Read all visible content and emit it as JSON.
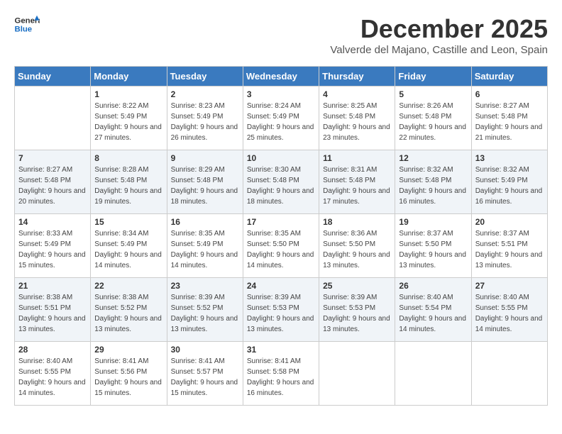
{
  "logo": {
    "general": "General",
    "blue": "Blue"
  },
  "title": "December 2025",
  "subtitle": "Valverde del Majano, Castille and Leon, Spain",
  "days_of_week": [
    "Sunday",
    "Monday",
    "Tuesday",
    "Wednesday",
    "Thursday",
    "Friday",
    "Saturday"
  ],
  "weeks": [
    [
      {
        "day": "",
        "sunrise": "",
        "sunset": "",
        "daylight": ""
      },
      {
        "day": "1",
        "sunrise": "Sunrise: 8:22 AM",
        "sunset": "Sunset: 5:49 PM",
        "daylight": "Daylight: 9 hours and 27 minutes."
      },
      {
        "day": "2",
        "sunrise": "Sunrise: 8:23 AM",
        "sunset": "Sunset: 5:49 PM",
        "daylight": "Daylight: 9 hours and 26 minutes."
      },
      {
        "day": "3",
        "sunrise": "Sunrise: 8:24 AM",
        "sunset": "Sunset: 5:49 PM",
        "daylight": "Daylight: 9 hours and 25 minutes."
      },
      {
        "day": "4",
        "sunrise": "Sunrise: 8:25 AM",
        "sunset": "Sunset: 5:48 PM",
        "daylight": "Daylight: 9 hours and 23 minutes."
      },
      {
        "day": "5",
        "sunrise": "Sunrise: 8:26 AM",
        "sunset": "Sunset: 5:48 PM",
        "daylight": "Daylight: 9 hours and 22 minutes."
      },
      {
        "day": "6",
        "sunrise": "Sunrise: 8:27 AM",
        "sunset": "Sunset: 5:48 PM",
        "daylight": "Daylight: 9 hours and 21 minutes."
      }
    ],
    [
      {
        "day": "7",
        "sunrise": "Sunrise: 8:27 AM",
        "sunset": "Sunset: 5:48 PM",
        "daylight": "Daylight: 9 hours and 20 minutes."
      },
      {
        "day": "8",
        "sunrise": "Sunrise: 8:28 AM",
        "sunset": "Sunset: 5:48 PM",
        "daylight": "Daylight: 9 hours and 19 minutes."
      },
      {
        "day": "9",
        "sunrise": "Sunrise: 8:29 AM",
        "sunset": "Sunset: 5:48 PM",
        "daylight": "Daylight: 9 hours and 18 minutes."
      },
      {
        "day": "10",
        "sunrise": "Sunrise: 8:30 AM",
        "sunset": "Sunset: 5:48 PM",
        "daylight": "Daylight: 9 hours and 18 minutes."
      },
      {
        "day": "11",
        "sunrise": "Sunrise: 8:31 AM",
        "sunset": "Sunset: 5:48 PM",
        "daylight": "Daylight: 9 hours and 17 minutes."
      },
      {
        "day": "12",
        "sunrise": "Sunrise: 8:32 AM",
        "sunset": "Sunset: 5:48 PM",
        "daylight": "Daylight: 9 hours and 16 minutes."
      },
      {
        "day": "13",
        "sunrise": "Sunrise: 8:32 AM",
        "sunset": "Sunset: 5:49 PM",
        "daylight": "Daylight: 9 hours and 16 minutes."
      }
    ],
    [
      {
        "day": "14",
        "sunrise": "Sunrise: 8:33 AM",
        "sunset": "Sunset: 5:49 PM",
        "daylight": "Daylight: 9 hours and 15 minutes."
      },
      {
        "day": "15",
        "sunrise": "Sunrise: 8:34 AM",
        "sunset": "Sunset: 5:49 PM",
        "daylight": "Daylight: 9 hours and 14 minutes."
      },
      {
        "day": "16",
        "sunrise": "Sunrise: 8:35 AM",
        "sunset": "Sunset: 5:49 PM",
        "daylight": "Daylight: 9 hours and 14 minutes."
      },
      {
        "day": "17",
        "sunrise": "Sunrise: 8:35 AM",
        "sunset": "Sunset: 5:50 PM",
        "daylight": "Daylight: 9 hours and 14 minutes."
      },
      {
        "day": "18",
        "sunrise": "Sunrise: 8:36 AM",
        "sunset": "Sunset: 5:50 PM",
        "daylight": "Daylight: 9 hours and 13 minutes."
      },
      {
        "day": "19",
        "sunrise": "Sunrise: 8:37 AM",
        "sunset": "Sunset: 5:50 PM",
        "daylight": "Daylight: 9 hours and 13 minutes."
      },
      {
        "day": "20",
        "sunrise": "Sunrise: 8:37 AM",
        "sunset": "Sunset: 5:51 PM",
        "daylight": "Daylight: 9 hours and 13 minutes."
      }
    ],
    [
      {
        "day": "21",
        "sunrise": "Sunrise: 8:38 AM",
        "sunset": "Sunset: 5:51 PM",
        "daylight": "Daylight: 9 hours and 13 minutes."
      },
      {
        "day": "22",
        "sunrise": "Sunrise: 8:38 AM",
        "sunset": "Sunset: 5:52 PM",
        "daylight": "Daylight: 9 hours and 13 minutes."
      },
      {
        "day": "23",
        "sunrise": "Sunrise: 8:39 AM",
        "sunset": "Sunset: 5:52 PM",
        "daylight": "Daylight: 9 hours and 13 minutes."
      },
      {
        "day": "24",
        "sunrise": "Sunrise: 8:39 AM",
        "sunset": "Sunset: 5:53 PM",
        "daylight": "Daylight: 9 hours and 13 minutes."
      },
      {
        "day": "25",
        "sunrise": "Sunrise: 8:39 AM",
        "sunset": "Sunset: 5:53 PM",
        "daylight": "Daylight: 9 hours and 13 minutes."
      },
      {
        "day": "26",
        "sunrise": "Sunrise: 8:40 AM",
        "sunset": "Sunset: 5:54 PM",
        "daylight": "Daylight: 9 hours and 14 minutes."
      },
      {
        "day": "27",
        "sunrise": "Sunrise: 8:40 AM",
        "sunset": "Sunset: 5:55 PM",
        "daylight": "Daylight: 9 hours and 14 minutes."
      }
    ],
    [
      {
        "day": "28",
        "sunrise": "Sunrise: 8:40 AM",
        "sunset": "Sunset: 5:55 PM",
        "daylight": "Daylight: 9 hours and 14 minutes."
      },
      {
        "day": "29",
        "sunrise": "Sunrise: 8:41 AM",
        "sunset": "Sunset: 5:56 PM",
        "daylight": "Daylight: 9 hours and 15 minutes."
      },
      {
        "day": "30",
        "sunrise": "Sunrise: 8:41 AM",
        "sunset": "Sunset: 5:57 PM",
        "daylight": "Daylight: 9 hours and 15 minutes."
      },
      {
        "day": "31",
        "sunrise": "Sunrise: 8:41 AM",
        "sunset": "Sunset: 5:58 PM",
        "daylight": "Daylight: 9 hours and 16 minutes."
      },
      {
        "day": "",
        "sunrise": "",
        "sunset": "",
        "daylight": ""
      },
      {
        "day": "",
        "sunrise": "",
        "sunset": "",
        "daylight": ""
      },
      {
        "day": "",
        "sunrise": "",
        "sunset": "",
        "daylight": ""
      }
    ]
  ]
}
